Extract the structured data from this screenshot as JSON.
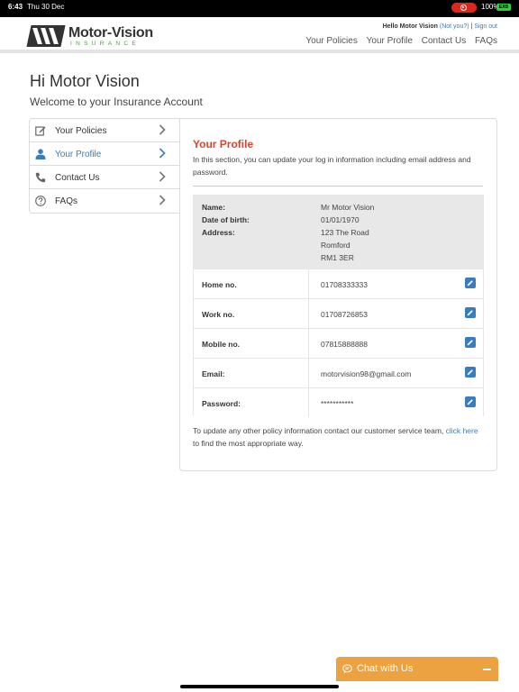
{
  "status_bar": {
    "time": "6:43",
    "date": "Thu 30 Dec",
    "battery_pct": "100%",
    "battery_label": "EXB"
  },
  "header": {
    "logo_title": "Motor-Vision",
    "logo_subtitle": "INSURANCE",
    "hello_name": "Hello Motor Vision",
    "not_you": "(Not you?)",
    "separator": "|",
    "sign_out": "Sign out",
    "nav": [
      "Your Policies",
      "Your Profile",
      "Contact Us",
      "FAQs"
    ]
  },
  "greeting": "Hi Motor Vision",
  "welcome": "Welcome to your Insurance Account",
  "sidebar": {
    "items": [
      {
        "label": "Your Policies",
        "icon": "edit-icon"
      },
      {
        "label": "Your Profile",
        "icon": "user-icon",
        "active": true
      },
      {
        "label": "Contact Us",
        "icon": "phone-icon"
      },
      {
        "label": "FAQs",
        "icon": "question-icon"
      }
    ]
  },
  "profile": {
    "title": "Your Profile",
    "intro": "In this section, you can update your log in information including email address and password.",
    "name_label": "Name:",
    "name_value": "Mr Motor Vision",
    "dob_label": "Date of birth:",
    "dob_value": "01/01/1970",
    "address_label": "Address:",
    "address_lines": [
      "123 The Road",
      "Romford",
      "RM1 3ER"
    ],
    "rows": [
      {
        "label": "Home no.",
        "value": "01708333333"
      },
      {
        "label": "Work no.",
        "value": "01708726853"
      },
      {
        "label": "Mobile no.",
        "value": "07815888888"
      },
      {
        "label": "Email:",
        "value": "motorvision98@gmail.com"
      },
      {
        "label": "Password:",
        "value": "***********"
      }
    ],
    "footer_text_1": "To update any other policy information contact our customer service team,",
    "footer_link_1": "click",
    "footer_link_2": "here",
    "footer_text_2": "to find the most appropriate way."
  },
  "chat": {
    "label": "Chat with Us"
  },
  "colors": {
    "accent_blue": "#3a7dbf",
    "title_red": "#d9452b",
    "chat_orange": "#eda242",
    "logo_green": "#43a537"
  }
}
